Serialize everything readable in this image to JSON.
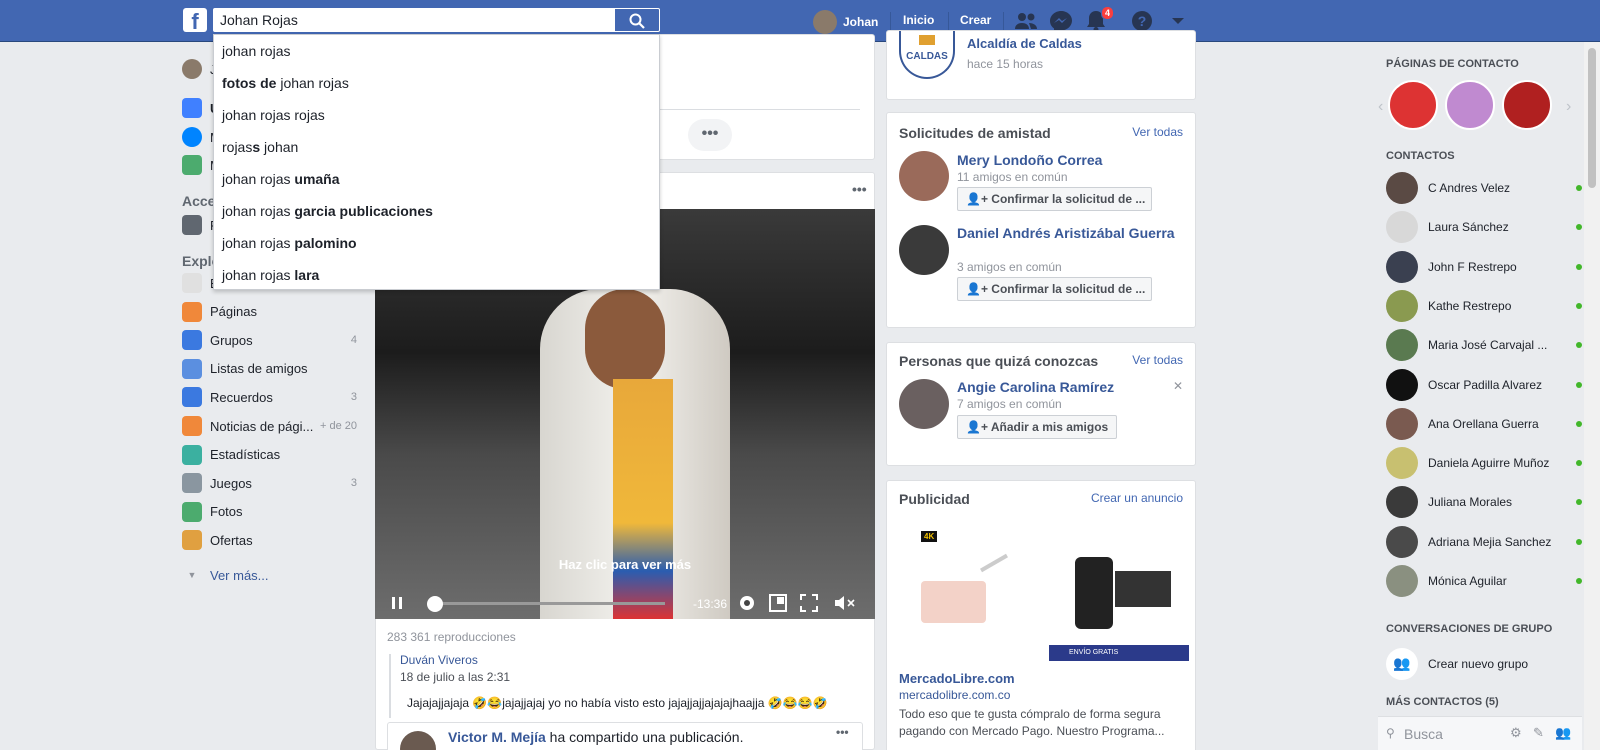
{
  "header": {
    "search_value": "Johan Rojas",
    "user_name": "Johan",
    "home_label": "Inicio",
    "create_label": "Crear",
    "notifications_count": "4",
    "brand_color": "#4267b2"
  },
  "search_suggestions": [
    {
      "pre": "johan rojas",
      "bold": "",
      "post": ""
    },
    {
      "pre": "",
      "bold": "fotos de",
      "post": " johan rojas"
    },
    {
      "pre": "johan rojas rojas",
      "bold": "",
      "post": ""
    },
    {
      "pre": "rojas",
      "bold": "s",
      "post": " johan"
    },
    {
      "pre": "johan rojas ",
      "bold": "umaña",
      "post": ""
    },
    {
      "pre": "johan rojas ",
      "bold": "garcia publicaciones",
      "post": ""
    },
    {
      "pre": "johan rojas ",
      "bold": "palomino",
      "post": ""
    },
    {
      "pre": "johan rojas ",
      "bold": "lara",
      "post": ""
    }
  ],
  "leftnav": {
    "profile_initial": "J",
    "top_items": [
      "U",
      "M",
      "M"
    ],
    "access_heading": "Acce",
    "access_item": "F",
    "explore_heading": "Explo",
    "explore_items": [
      {
        "label": "Eventos",
        "count": "",
        "icon": "calendar-icon",
        "color": "#e0e0e0"
      },
      {
        "label": "Páginas",
        "count": "",
        "icon": "flag-icon",
        "color": "#f0883a"
      },
      {
        "label": "Grupos",
        "count": "4",
        "icon": "groups-icon",
        "color": "#3b79e0"
      },
      {
        "label": "Listas de amigos",
        "count": "",
        "icon": "friend-list-icon",
        "color": "#5b8fe0"
      },
      {
        "label": "Recuerdos",
        "count": "3",
        "icon": "memories-icon",
        "color": "#3b79e0"
      },
      {
        "label": "Noticias de pági...",
        "count": "+ de 20",
        "icon": "page-news-icon",
        "color": "#f0883a"
      },
      {
        "label": "Estadísticas",
        "count": "",
        "icon": "stats-icon",
        "color": "#3bb0a0"
      },
      {
        "label": "Juegos",
        "count": "3",
        "icon": "gamepad-icon",
        "color": "#8a96a0"
      },
      {
        "label": "Fotos",
        "count": "",
        "icon": "photos-icon",
        "color": "#4cab6e"
      },
      {
        "label": "Ofertas",
        "count": "",
        "icon": "offers-icon",
        "color": "#e0a040"
      }
    ],
    "see_more": "Ver más..."
  },
  "feed": {
    "video_hint": "Haz clic para ver más",
    "video_time": "-13:36",
    "video_progress": 0.02,
    "views": "283 361 reproducciones",
    "comment_author": "Duván Viveros",
    "comment_date": "18 de julio a las 2:31",
    "comment_text": "Jajajajjajaja 🤣😂jajajjajaj yo no había visto esto jajajjajjajajajhaajja 🤣😂😂🤣",
    "share_author": "Victor M. Mejía",
    "share_text": " ha compartido una publicación."
  },
  "right": {
    "top_page_name": "Alcaldía de Caldas",
    "top_page_time": "hace 15 horas",
    "top_page_logo": "CALDAS",
    "friend_requests_title": "Solicitudes de amistad",
    "see_all": "Ver todas",
    "requests": [
      {
        "name": "Mery Londoño Correa",
        "mutual": "11 amigos en común",
        "button": "Confirmar la solicitud de ..."
      },
      {
        "name": "Daniel Andrés Aristizábal Guerra",
        "mutual": "3 amigos en común",
        "button": "Confirmar la solicitud de ..."
      }
    ],
    "pymk_title": "Personas que quizá conozcas",
    "pymk": {
      "name": "Angie Carolina Ramírez",
      "mutual": "7 amigos en común",
      "button": "Añadir a mis amigos"
    },
    "ads_title": "Publicidad",
    "create_ad": "Crear un anuncio",
    "ad_brand": "MercadoLibre.com",
    "ad_url": "mercadolibre.com.co",
    "ad_text": "Todo eso que te gusta cómpralo de forma segura pagando con Mercado Pago. Nuestro Programa...",
    "ad_badge_4k": "4K",
    "ad_banner": "ENVÍO GRATIS"
  },
  "chat": {
    "pages_heading": "PÁGINAS DE CONTACTO",
    "contacts_heading": "CONTACTOS",
    "contacts": [
      {
        "name": "C Andres Velez",
        "color": "#5a4a44"
      },
      {
        "name": "Laura Sánchez",
        "color": "#d8d8d8"
      },
      {
        "name": "John F Restrepo",
        "color": "#3a4050"
      },
      {
        "name": "Kathe Restrepo",
        "color": "#8a9a50"
      },
      {
        "name": "Maria José Carvajal ...",
        "color": "#5a7a50"
      },
      {
        "name": "Oscar Padilla Alvarez",
        "color": "#111111"
      },
      {
        "name": "Ana Orellana Guerra",
        "color": "#7a5a50"
      },
      {
        "name": "Daniela Aguirre Muñoz",
        "color": "#c8c070"
      },
      {
        "name": "Juliana Morales",
        "color": "#3a3a3a"
      },
      {
        "name": "Adriana Mejia Sanchez",
        "color": "#4a4a4a"
      },
      {
        "name": "Mónica Aguilar",
        "color": "#8a9080"
      }
    ],
    "group_heading": "CONVERSACIONES DE GRUPO",
    "new_group": "Crear nuevo grupo",
    "more_contacts": "MÁS CONTACTOS (5)",
    "search_placeholder": "Busca"
  }
}
